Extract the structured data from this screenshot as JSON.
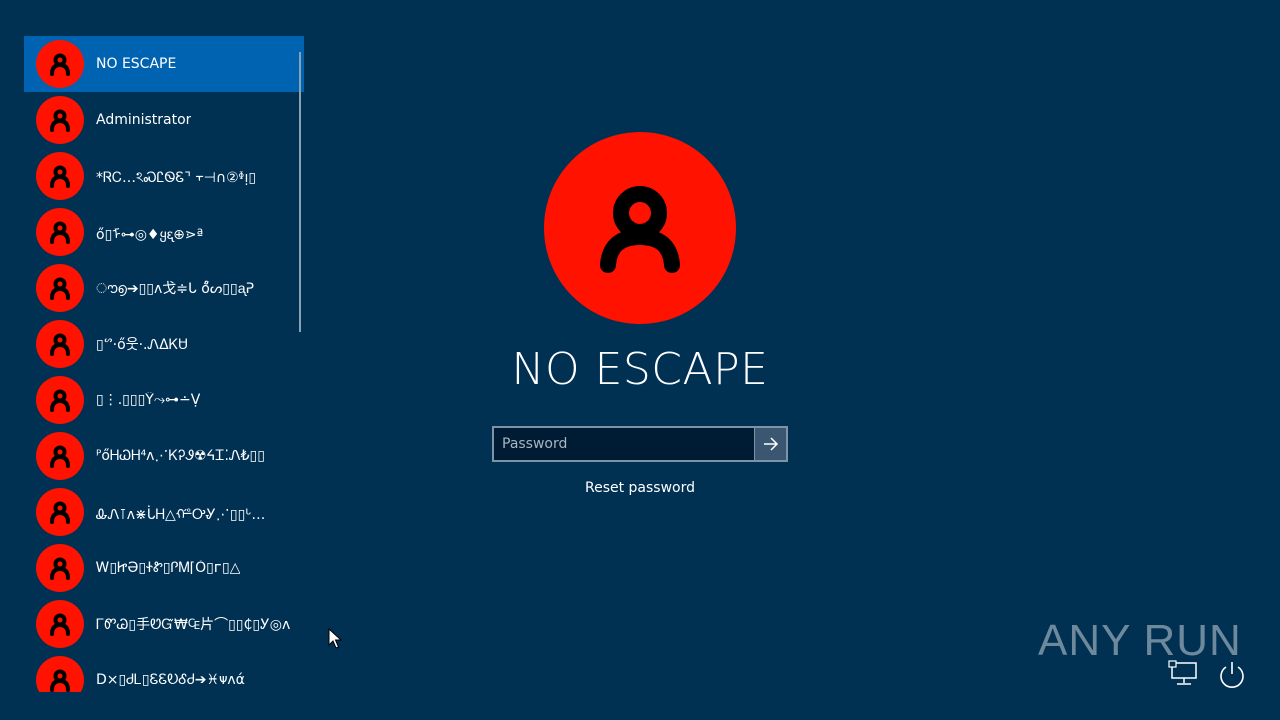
{
  "users": [
    {
      "name": "NO ESCAPE",
      "selected": true
    },
    {
      "name": "Administrator"
    },
    {
      "name": "*ᏒᏟ…ঽᏍᏝᏫᏋ⌝ ᠇⊣∩②ᶲᴉ▯"
    },
    {
      "name": "ő▯ᠮ⊶◎♦ყᶓ⊕⋗ª"
    },
    {
      "name": "ൗ൭➔▯▯ᴧ戈≑ᒐ  ő̊ᔕ▯▯ᶏᕈ"
    },
    {
      "name": "▯ᔥ·ő웃·.ᏁᐃᏦᏌ"
    },
    {
      "name": "▯⋮.▯▯▯Ŷ⤳⊶∸Ṿ"
    },
    {
      "name": "ᴾőᎻᏇᎻ⁴ᴧ⋰ᏦᎮᏭ☢ᔦᏆ⁚Ꮑ₺▯▯"
    },
    {
      "name": "ᎲᏁ⊺ᴧ⋇ᒑᎻ△ᢚᎤᎽ⋰▯▯ᒡ…"
    },
    {
      "name": "Ꮃ▯ᏥӘ▯ᏐᏑ▯ᎵᎷ⌈Ò▯ᴦ▯△"
    },
    {
      "name": "ᎱᏛᏊ▯手ᏬᏳ₩₠片⌒▯▯₵▯Ꭹ◎ᴧ"
    },
    {
      "name": "D⨯▯ᏧᏞ▯ᏋᏋᎧᎴᏧ➔♓ᴪᴧά"
    }
  ],
  "account": {
    "title": "NO ESCAPE"
  },
  "password": {
    "placeholder": "Password",
    "value": ""
  },
  "reset_link": "Reset password",
  "watermark": {
    "left": "ANY",
    "right": "RUN"
  },
  "colors": {
    "background": "#003153",
    "selected": "#0063b1",
    "avatar": "#ff1200"
  },
  "icons": {
    "avatar": "user-figure-icon",
    "submit": "arrow-right-icon",
    "network": "network-icon",
    "power": "power-icon"
  }
}
